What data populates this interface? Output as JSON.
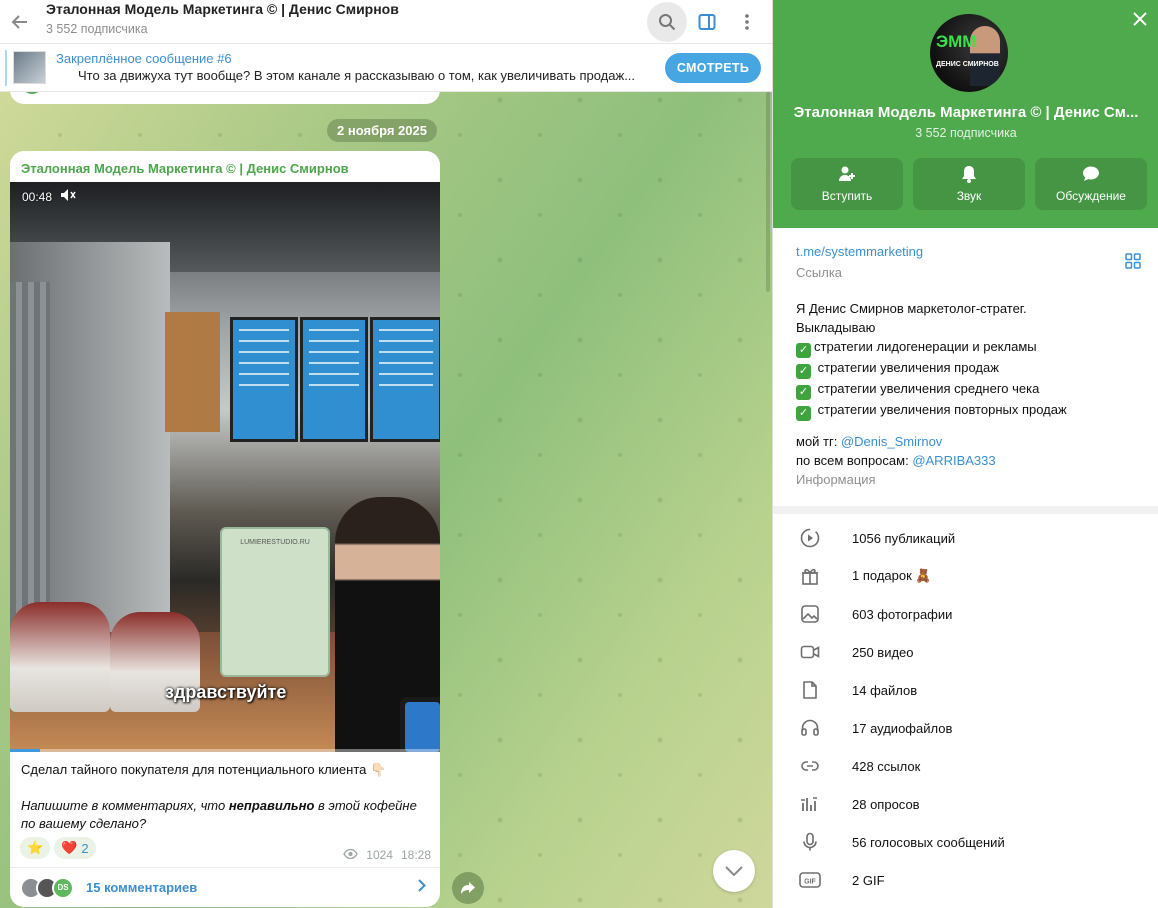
{
  "chat": {
    "title": "Эталонная Модель Маркетинга © | Денис Смирнов",
    "subtitle": "3 552 подписчика",
    "pinned": {
      "title": "Закреплённое сообщение #6",
      "body": "Что за движуха тут вообще?  В этом канале я рассказываю о том, как увеличивать продаж...",
      "button": "СМОТРЕТЬ"
    },
    "date_chip": "2 ноября 2025",
    "post": {
      "author": "Эталонная Модель Маркетинга © | Денис Смирнов",
      "video_time": "00:48",
      "video_caption": "здравствуйте",
      "text_line1": "Сделал тайного покупателя для потенциального клиента 👇🏻",
      "text_line2_a": "Напишите в комментариях, что ",
      "text_line2_b": "неправильно",
      "text_line2_c": " в этой кофейне по вашему сделано?",
      "reaction_star": "⭐",
      "reaction_heart": "❤️",
      "reaction_heart_count": "2",
      "views": "1024",
      "time": "18:28",
      "comments_label": "15 комментариев",
      "commenter_initials": "DS",
      "stand_label": "LUMIERESTUDIO.RU"
    }
  },
  "panel": {
    "avatar_logo": "ЭММ",
    "avatar_name": "ДЕНИС СМИРНОВ",
    "name": "Эталонная Модель Маркетинга © | Денис См...",
    "subscribers": "3 552 подписчика",
    "actions": [
      {
        "label": "Вступить",
        "icon": "add-user-icon"
      },
      {
        "label": "Звук",
        "icon": "bell-icon"
      },
      {
        "label": "Обсуждение",
        "icon": "chat-bubble-icon"
      }
    ],
    "link": "t.me/systemmarketing",
    "link_caption": "Ссылка",
    "desc_intro": "Я Денис Смирнов маркетолог-стратег.\nВыкладываю",
    "desc_items": [
      "стратегии лидогенерации и рекламы",
      "стратегии увеличения продаж",
      "стратегии увеличения среднего чека",
      "стратегии увеличения повторных продаж"
    ],
    "my_tg_label": "мой тг: ",
    "my_tg": "@Denis_Smirnov",
    "questions_label": "по всем вопросам: ",
    "questions": "@ARRIBA333",
    "info_caption": "Информация",
    "stats": [
      {
        "label": "1056 публикаций",
        "icon": "play-circle-icon"
      },
      {
        "label": "1 подарок 🧸",
        "icon": "gift-icon"
      },
      {
        "label": "603 фотографии",
        "icon": "photo-icon"
      },
      {
        "label": "250 видео",
        "icon": "video-icon"
      },
      {
        "label": "14 файлов",
        "icon": "file-icon"
      },
      {
        "label": "17 аудиофайлов",
        "icon": "headphones-icon"
      },
      {
        "label": "428 ссылок",
        "icon": "link-icon"
      },
      {
        "label": "28 опросов",
        "icon": "poll-icon"
      },
      {
        "label": "56 голосовых сообщений",
        "icon": "microphone-icon"
      },
      {
        "label": "2 GIF",
        "icon": "gif-icon"
      }
    ]
  }
}
